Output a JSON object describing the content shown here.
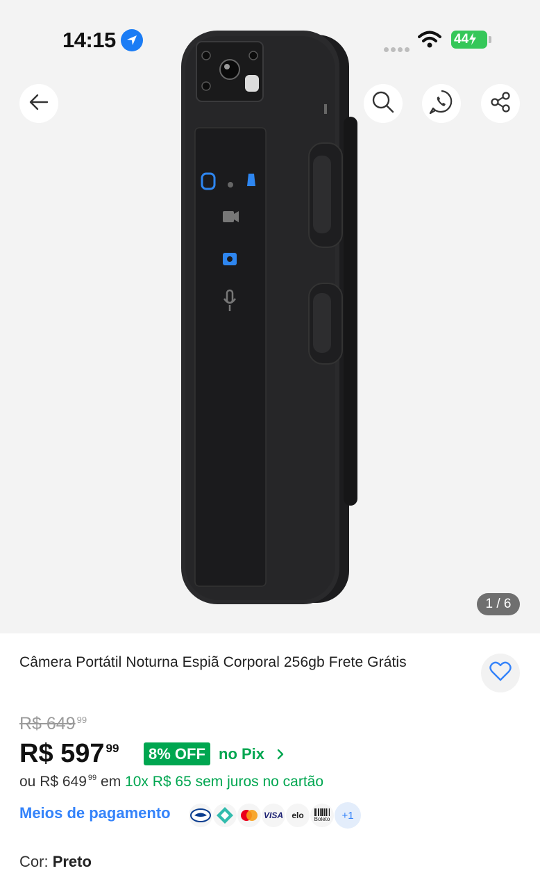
{
  "status_bar": {
    "time": "14:15",
    "battery": "44"
  },
  "gallery": {
    "counter": "1 / 6"
  },
  "product": {
    "title": "Câmera Portátil Noturna Espiã Corporal 256gb Frete Grátis",
    "old_price": "R$ 649",
    "old_price_cents": "99",
    "price": "R$ 597",
    "price_cents": "99",
    "discount_badge": "8% OFF",
    "pix_label": "no Pix",
    "installments_prefix": "ou",
    "installments_price": "R$ 649",
    "installments_price_cents": "99",
    "installments_em": "em",
    "installments_detail": "10x R$ 65 sem juros no cartão",
    "payment_link": "Meios de pagamento",
    "payment_icons": [
      "mercado-pago-icon",
      "pix-icon",
      "mastercard-icon",
      "visa-icon",
      "elo-icon",
      "boleto-icon"
    ],
    "payment_labels": {
      "visa": "VISA",
      "elo": "elo",
      "boleto": "Boleto",
      "more": "+1"
    },
    "color_label": "Cor:",
    "color_value": "Preto"
  },
  "colors": {
    "green": "#00a650",
    "blue": "#3483fa",
    "ios_blue": "#1a7cf5",
    "battery_green": "#35c759"
  }
}
